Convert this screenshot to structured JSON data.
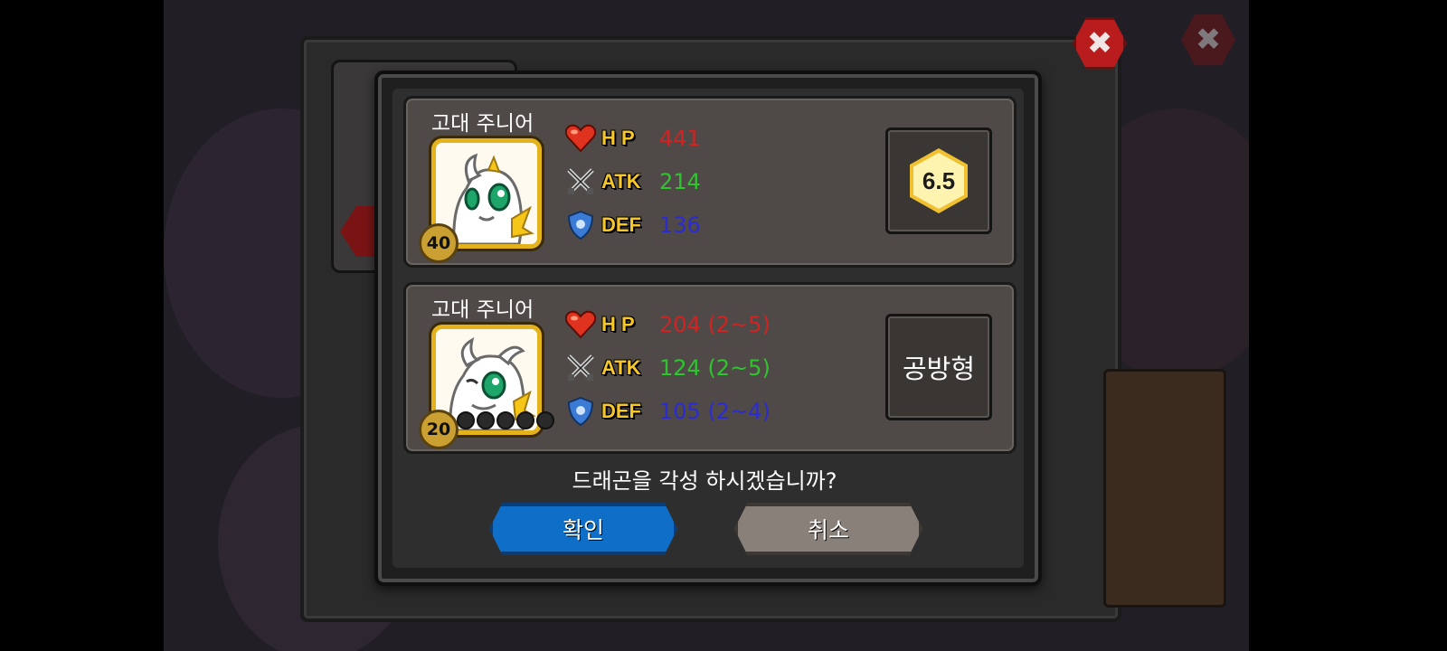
{
  "colors": {
    "hp": "#d22323",
    "atk": "#2fc52f",
    "def": "#2b2bcf",
    "confirm": "#0f6ec7",
    "cancel": "#8a807a",
    "close": "#b81c1c"
  },
  "cards": [
    {
      "name": "고대 주니어",
      "level": "40",
      "stats": {
        "hp_label": "H P",
        "hp_value": "441",
        "atk_label": "ATK",
        "atk_value": "214",
        "def_label": "DEF",
        "def_value": "136"
      },
      "grade": "6.5"
    },
    {
      "name": "고대 주니어",
      "level": "20",
      "star_count": 5,
      "stats": {
        "hp_label": "H P",
        "hp_value": "204 (2~5)",
        "atk_label": "ATK",
        "atk_value": "124 (2~5)",
        "def_label": "DEF",
        "def_value": "105 (2~4)"
      },
      "type": "공방형"
    }
  ],
  "dialog": {
    "question": "드래곤을 각성 하시겠습니까?",
    "confirm_label": "확인",
    "cancel_label": "취소"
  },
  "icons": {
    "hp": "heart-icon",
    "atk": "crossed-swords-icon",
    "def": "shield-icon",
    "close": "close-icon",
    "grade": "grade-hexagon-icon"
  }
}
